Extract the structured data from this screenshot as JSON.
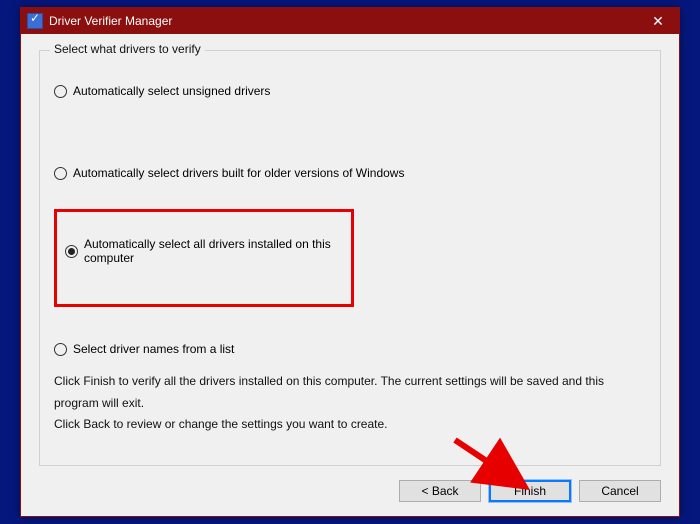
{
  "titlebar": {
    "title": "Driver Verifier Manager"
  },
  "group": {
    "legend": "Select what drivers to verify",
    "options": {
      "opt1": "Automatically select unsigned drivers",
      "opt2": "Automatically select drivers built for older versions of Windows",
      "opt3": "Automatically select all drivers installed on this computer",
      "opt4": "Select driver names from a list"
    },
    "instructions_line1": "Click Finish to verify all the drivers installed on this computer. The current settings will be saved and this program will exit.",
    "instructions_line2": "Click Back to review or change the settings you want to create."
  },
  "buttons": {
    "back": "< Back",
    "finish": "Finish",
    "cancel": "Cancel"
  },
  "annotation": {
    "color": "#e60000"
  }
}
